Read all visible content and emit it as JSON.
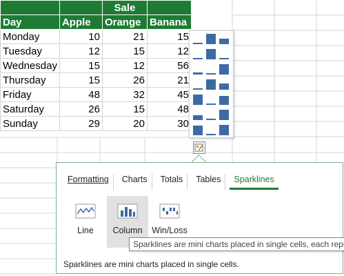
{
  "sheet": {
    "header_top": "Sale",
    "headers": [
      "Day",
      "Apple",
      "Orange",
      "Banana"
    ],
    "rows": [
      {
        "day": "Monday",
        "apple": "10",
        "orange": "21",
        "banana": "15"
      },
      {
        "day": "Tuesday",
        "apple": "12",
        "orange": "15",
        "banana": "12"
      },
      {
        "day": "Wednesday",
        "apple": "15",
        "orange": "12",
        "banana": "56"
      },
      {
        "day": "Thursday",
        "apple": "15",
        "orange": "26",
        "banana": "21"
      },
      {
        "day": "Friday",
        "apple": "48",
        "orange": "32",
        "banana": "45"
      },
      {
        "day": "Saturday",
        "apple": "26",
        "orange": "15",
        "banana": "48"
      },
      {
        "day": "Sunday",
        "apple": "29",
        "orange": "20",
        "banana": "30"
      }
    ]
  },
  "quick_analysis": {
    "tabs": [
      "Formatting",
      "Charts",
      "Totals",
      "Tables",
      "Sparklines"
    ],
    "active_tab": "Sparklines",
    "options": [
      {
        "label": "Line",
        "icon": "sparkline-line-icon"
      },
      {
        "label": "Column",
        "icon": "sparkline-column-icon"
      },
      {
        "label": "Win/Loss",
        "icon": "sparkline-winloss-icon"
      }
    ],
    "tooltip": "Sparklines are mini charts placed in single cells, each repre",
    "footer": "Sparklines are mini charts placed in single cells."
  },
  "colors": {
    "header_green": "#1e7b34",
    "spark_blue": "#3e6aa4"
  }
}
